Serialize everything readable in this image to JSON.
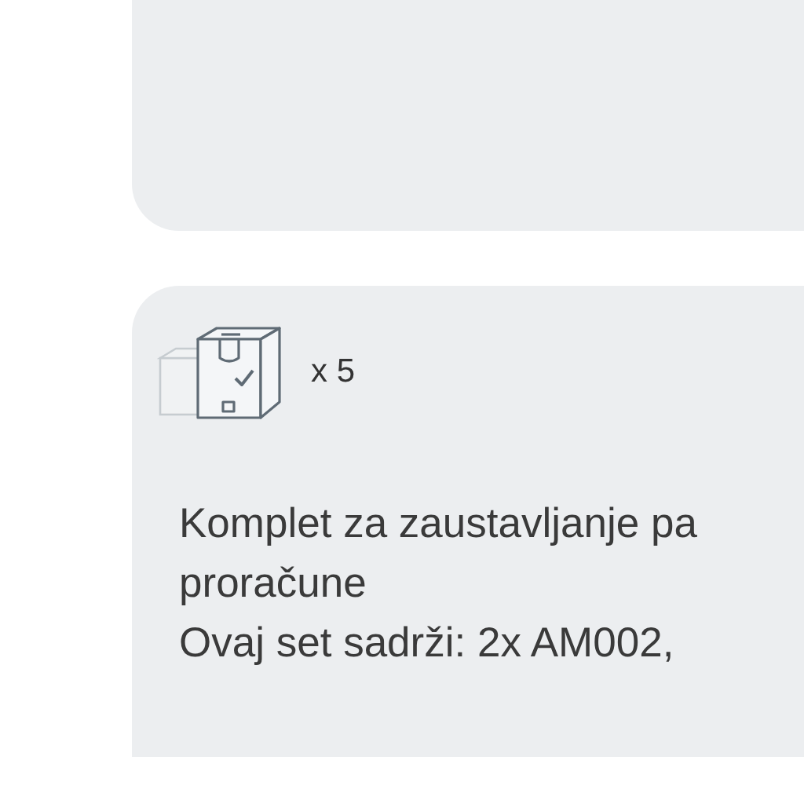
{
  "item": {
    "quantity": "x 5",
    "description_lines": [
      "Komplet za zaustavljanje pa",
      "proračune",
      "Ovaj set sadrži: 2x AM002,"
    ]
  }
}
